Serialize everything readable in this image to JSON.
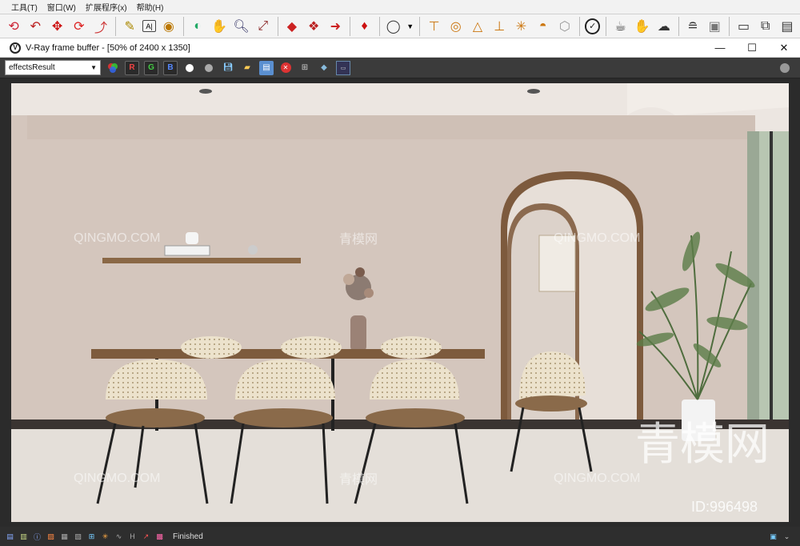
{
  "menubar": {
    "items": [
      "工具(T)",
      "窗口(W)",
      "扩展程序(x)",
      "帮助(H)"
    ]
  },
  "toolbar": {
    "groups": [
      [
        "🛞",
        "🪝",
        "✥",
        "⟳",
        "⤴"
      ],
      [
        "🔑",
        "AI",
        "🎨"
      ],
      [
        "◐",
        "✂",
        "🔍",
        "⤢"
      ],
      [
        "🟥",
        "🎁",
        "➜"
      ],
      [
        "💎"
      ],
      [
        "👤",
        "▾"
      ],
      [
        "⊤",
        "◎",
        "△",
        "⊥",
        "✳",
        "◓",
        "⬡"
      ],
      [
        "✔"
      ],
      [
        "🫖",
        "🖐",
        "☁"
      ],
      [
        "⊞",
        "⊟"
      ],
      [
        "▭",
        "🗔",
        "⧉"
      ]
    ]
  },
  "vfb": {
    "logo": "V",
    "title": "V-Ray frame buffer - [50% of 2400 x 1350]",
    "window_buttons": [
      "—",
      "☐",
      "✕"
    ],
    "channel": "effectsResult",
    "channel_buttons": [
      "R",
      "G",
      "B"
    ],
    "status": "Finished"
  },
  "render": {
    "watermark_text": "QINGMO.COM",
    "watermark_cn": "青模网",
    "big_watermark": "青模网",
    "id_text": "ID:996498"
  },
  "colors": {
    "wall": "#d6c9c0",
    "floor": "#e6e2dd",
    "wood": "#8a6a4a",
    "rattan": "#e8dcc4",
    "plant": "#4a6a3a"
  }
}
